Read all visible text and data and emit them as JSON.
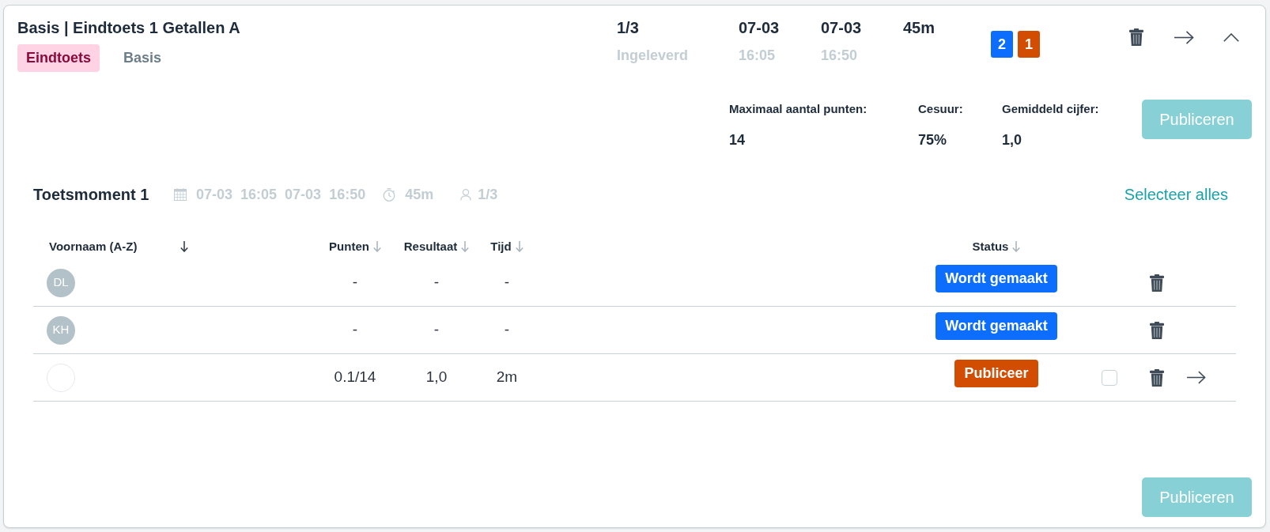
{
  "header": {
    "title": "Basis | Eindtoets 1 Getallen A",
    "tags": [
      {
        "label": "Eindtoets",
        "kind": "category"
      },
      {
        "label": "Basis",
        "kind": "level"
      }
    ],
    "expanded": true
  },
  "summary": [
    {
      "value": "1/3",
      "caption": "Ingeleverd"
    },
    {
      "value": "07-03",
      "caption": "16:05"
    },
    {
      "value": "07-03",
      "caption": "16:50"
    },
    {
      "value": "45m"
    }
  ],
  "counters": [
    {
      "label": "2",
      "color": "#0d6efd"
    },
    {
      "label": "1",
      "color": "#d24c02"
    }
  ],
  "stats": [
    {
      "label": "Maximaal aantal punten:",
      "value": "14"
    },
    {
      "label": "Cesuur:",
      "value": "75%"
    },
    {
      "label": "Gemiddeld cijfer:",
      "value": "1,0"
    }
  ],
  "publish_button": {
    "label": "Publiceren",
    "disabled": true
  },
  "session": {
    "title": "Toetsmoment 1",
    "start_date": "07-03",
    "start_time": "16:05",
    "end_date": "07-03",
    "end_time": "16:50",
    "duration": "45m",
    "participants": "1/3",
    "select_all": "Selecteer alles"
  },
  "table": {
    "columns": [
      {
        "label": "Voornaam (A-Z)",
        "sort_active": true
      },
      {
        "label": "Punten",
        "sort_active": false
      },
      {
        "label": "Resultaat",
        "sort_active": false
      },
      {
        "label": "Tijd",
        "sort_active": false
      },
      {
        "label": "Status",
        "sort_active": false
      }
    ],
    "rows": [
      {
        "kind": "in_progress",
        "initials": "DL",
        "points": "-",
        "result": "-",
        "time": "-",
        "status": {
          "label": "Wordt gemaakt",
          "color": "#0d6efd"
        }
      },
      {
        "kind": "in_progress",
        "initials": "KH",
        "points": "-",
        "result": "-",
        "time": "-",
        "status": {
          "label": "Wordt gemaakt",
          "color": "#0d6efd"
        }
      },
      {
        "kind": "submitted",
        "points": "0.1/14",
        "result": "1,0",
        "time": "2m",
        "status": {
          "label": "Publiceer",
          "color": "#d24c02"
        },
        "checked": false
      }
    ]
  },
  "footer_button": {
    "label": "Publiceren",
    "disabled": true
  }
}
